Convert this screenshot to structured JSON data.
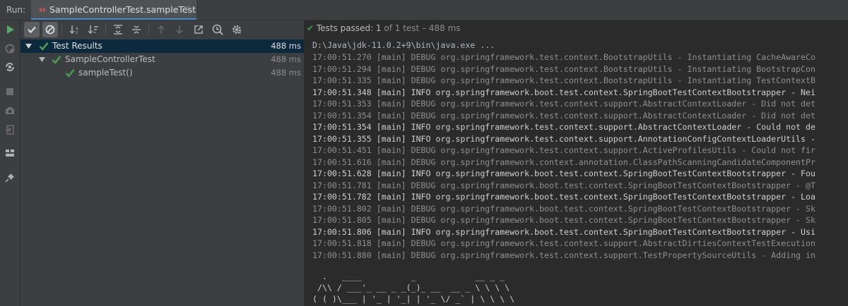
{
  "run_label": "Run:",
  "tab": {
    "label": "SampleControllerTest.sampleTest",
    "close": "×"
  },
  "status": {
    "check": "✔",
    "prefix": "Tests passed: ",
    "count": "1",
    "suffix": " of 1 test – 488 ms"
  },
  "tree": [
    {
      "label": "Test Results",
      "time": "488 ms"
    },
    {
      "label": "SampleControllerTest",
      "time": "488 ms"
    },
    {
      "label": "sampleTest()",
      "time": "488 ms"
    }
  ],
  "console": {
    "command": "D:\\Java\\jdk-11.0.2+9\\bin\\java.exe ...",
    "lines": [
      {
        "level": "DEBUG",
        "text": "17:00:51.270 [main] DEBUG org.springframework.test.context.BootstrapUtils - Instantiating CacheAwareCo"
      },
      {
        "level": "DEBUG",
        "text": "17:00:51.294 [main] DEBUG org.springframework.test.context.BootstrapUtils - Instantiating BootstrapCon"
      },
      {
        "level": "DEBUG",
        "text": "17:00:51.335 [main] DEBUG org.springframework.test.context.BootstrapUtils - Instantiating TestContextB"
      },
      {
        "level": "INFO",
        "text": "17:00:51.348 [main] INFO org.springframework.boot.test.context.SpringBootTestContextBootstrapper - Nei"
      },
      {
        "level": "DEBUG",
        "text": "17:00:51.353 [main] DEBUG org.springframework.test.context.support.AbstractContextLoader - Did not det"
      },
      {
        "level": "DEBUG",
        "text": "17:00:51.354 [main] DEBUG org.springframework.test.context.support.AbstractContextLoader - Did not det"
      },
      {
        "level": "INFO",
        "text": "17:00:51.354 [main] INFO org.springframework.test.context.support.AbstractContextLoader - Could not de"
      },
      {
        "level": "INFO",
        "text": "17:00:51.355 [main] INFO org.springframework.test.context.support.AnnotationConfigContextLoaderUtils -"
      },
      {
        "level": "DEBUG",
        "text": "17:00:51.451 [main] DEBUG org.springframework.test.context.support.ActiveProfilesUtils - Could not fir"
      },
      {
        "level": "DEBUG",
        "text": "17:00:51.616 [main] DEBUG org.springframework.context.annotation.ClassPathScanningCandidateComponentPr"
      },
      {
        "level": "INFO",
        "text": "17:00:51.628 [main] INFO org.springframework.boot.test.context.SpringBootTestContextBootstrapper - Fou"
      },
      {
        "level": "DEBUG",
        "text": "17:00:51.781 [main] DEBUG org.springframework.boot.test.context.SpringBootTestContextBootstrapper - @T"
      },
      {
        "level": "INFO",
        "text": "17:00:51.782 [main] INFO org.springframework.boot.test.context.SpringBootTestContextBootstrapper - Loa"
      },
      {
        "level": "DEBUG",
        "text": "17:00:51.802 [main] DEBUG org.springframework.boot.test.context.SpringBootTestContextBootstrapper - Sk"
      },
      {
        "level": "DEBUG",
        "text": "17:00:51.805 [main] DEBUG org.springframework.boot.test.context.SpringBootTestContextBootstrapper - Sk"
      },
      {
        "level": "INFO",
        "text": "17:00:51.806 [main] INFO org.springframework.boot.test.context.SpringBootTestContextBootstrapper - Usi"
      },
      {
        "level": "DEBUG",
        "text": "17:00:51.818 [main] DEBUG org.springframework.test.context.support.AbstractDirtiesContextTestExecution"
      },
      {
        "level": "DEBUG",
        "text": "17:00:51.880 [main] DEBUG org.springframework.test.context.support.TestPropertySourceUtils - Adding in"
      }
    ],
    "banner": [
      "  .   ____          _            __ _ _",
      " /\\\\ / ___'_ __ _ _(_)_ __  __ _ \\ \\ \\ \\",
      "( ( )\\___ | '_ | '_| | '_ \\/ _` | \\ \\ \\ \\"
    ]
  },
  "colors": {
    "pass_green": "#499c54",
    "run_green": "#59a869",
    "selection": "#0d293e",
    "accent": "#4a88c7"
  }
}
